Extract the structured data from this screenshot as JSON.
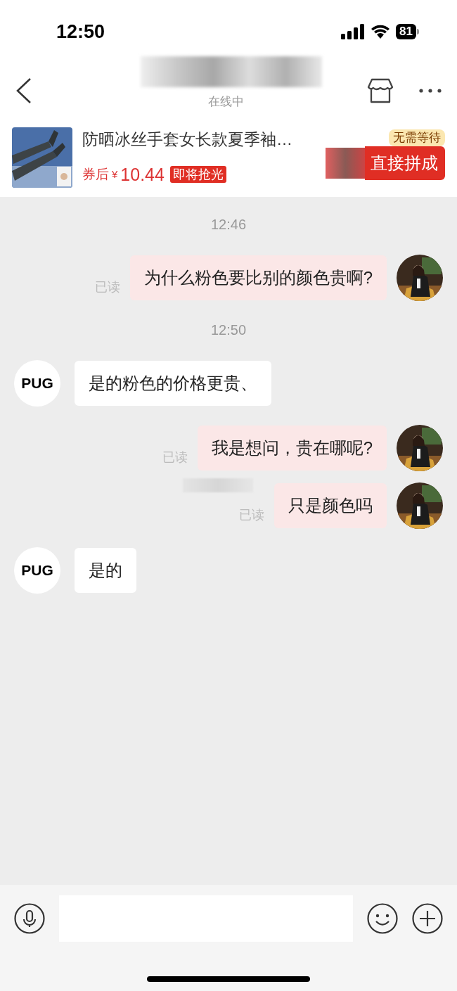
{
  "status_bar": {
    "time": "12:50",
    "battery": "81"
  },
  "header": {
    "subtitle": "在线中"
  },
  "product": {
    "title": "防晒冰丝手套女长款夏季袖…",
    "price_prefix": "券后",
    "currency": "¥",
    "price": "10.44",
    "tag": "即将抢光",
    "badge": "无需等待",
    "button": "直接拼成"
  },
  "messages": [
    {
      "kind": "time",
      "text": "12:46"
    },
    {
      "kind": "sent",
      "text": "为什么粉色要比别的颜色贵啊?",
      "read_label": "已读"
    },
    {
      "kind": "time",
      "text": "12:50"
    },
    {
      "kind": "received",
      "text": "是的粉色的价格更贵、",
      "avatar": "PUG"
    },
    {
      "kind": "sent",
      "text": "我是想问，贵在哪呢?",
      "read_label": "已读"
    },
    {
      "kind": "redacted"
    },
    {
      "kind": "sent",
      "text": "只是颜色吗",
      "read_label": "已读"
    },
    {
      "kind": "received",
      "text": "是的",
      "avatar": "PUG"
    }
  ]
}
